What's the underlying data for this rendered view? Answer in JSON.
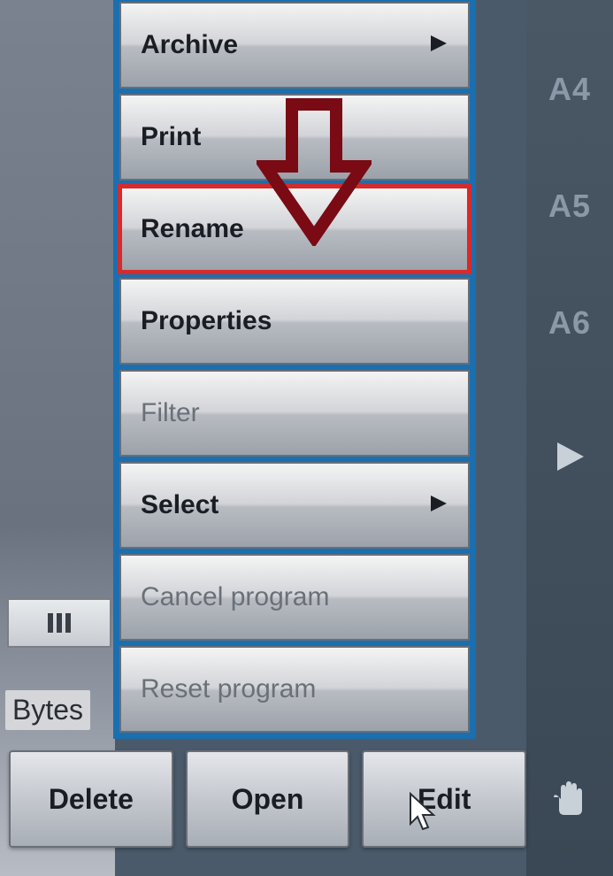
{
  "rail": {
    "labels": [
      "A4",
      "A5",
      "A6"
    ]
  },
  "left": {
    "bytes_label": "Bytes"
  },
  "menu": {
    "items": [
      {
        "label": "Archive",
        "enabled": true,
        "submenu": true,
        "highlighted": false
      },
      {
        "label": "Print",
        "enabled": true,
        "submenu": false,
        "highlighted": false
      },
      {
        "label": "Rename",
        "enabled": true,
        "submenu": false,
        "highlighted": true
      },
      {
        "label": "Properties",
        "enabled": true,
        "submenu": false,
        "highlighted": false
      },
      {
        "label": "Filter",
        "enabled": false,
        "submenu": false,
        "highlighted": false
      },
      {
        "label": "Select",
        "enabled": true,
        "submenu": true,
        "highlighted": false
      },
      {
        "label": "Cancel program",
        "enabled": false,
        "submenu": false,
        "highlighted": false
      },
      {
        "label": "Reset program",
        "enabled": false,
        "submenu": false,
        "highlighted": false
      }
    ]
  },
  "buttons": {
    "delete": "Delete",
    "open": "Open",
    "edit": "Edit"
  }
}
